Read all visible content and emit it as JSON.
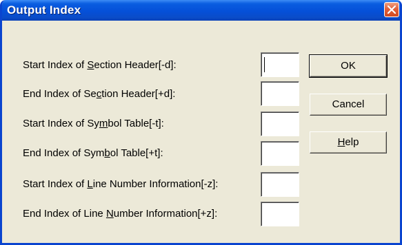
{
  "window": {
    "title": "Output Index"
  },
  "fields": [
    {
      "label_pre": "Start Index of ",
      "label_acc": "S",
      "label_post": "ection Header[-d]:",
      "value": ""
    },
    {
      "label_pre": "End Index of Se",
      "label_acc": "c",
      "label_post": "tion Header[+d]:",
      "value": ""
    },
    {
      "label_pre": "Start Index of Sy",
      "label_acc": "m",
      "label_post": "bol Table[-t]:",
      "value": ""
    },
    {
      "label_pre": "End Index of Sym",
      "label_acc": "b",
      "label_post": "ol Table[+t]:",
      "value": ""
    },
    {
      "label_pre": "Start Index of ",
      "label_acc": "L",
      "label_post": "ine Number Information[-z]:",
      "value": ""
    },
    {
      "label_pre": "End Index of Line ",
      "label_acc": "N",
      "label_post": "umber Information[+z]:",
      "value": ""
    }
  ],
  "buttons": {
    "ok": "OK",
    "cancel": "Cancel",
    "help_acc": "H",
    "help_post": "elp"
  },
  "colors": {
    "titlebar": "#0550d8",
    "dialog_bg": "#ece9d8",
    "close_button": "#e2603a"
  },
  "icons": {
    "close": "close-icon"
  }
}
